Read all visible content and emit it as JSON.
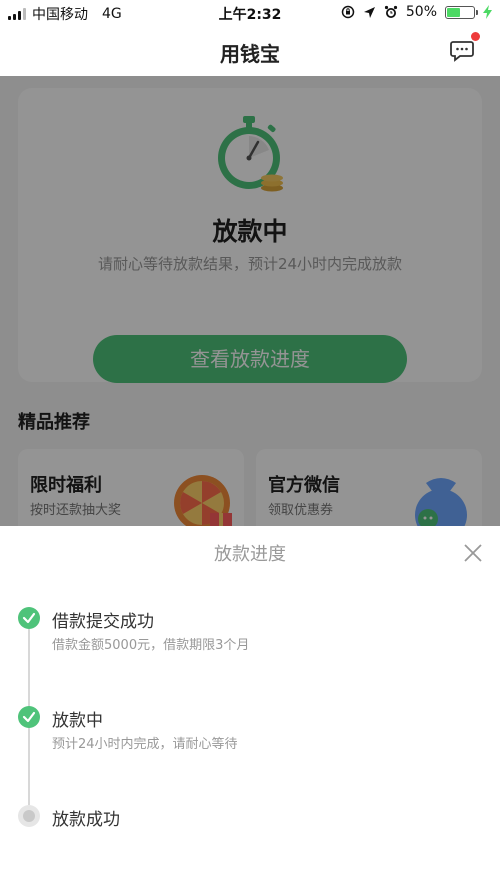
{
  "status_bar": {
    "carrier": "中国移动",
    "network": "4G",
    "time": "上午2:32",
    "battery": "50%",
    "battery_level": 0.5
  },
  "nav": {
    "title": "用钱宝",
    "has_unread": true
  },
  "status_card": {
    "title": "放款中",
    "description": "请耐心等待放款结果，预计24小时内完成放款",
    "button_label": "查看放款进度"
  },
  "recommend": {
    "title": "精品推荐",
    "items": [
      {
        "title": "限时福利",
        "subtitle": "按时还款抽大奖"
      },
      {
        "title": "官方微信",
        "subtitle": "领取优惠券"
      }
    ]
  },
  "sheet": {
    "title": "放款进度",
    "steps": [
      {
        "title": "借款提交成功",
        "subtitle": "借款金额5000元，借款期限3个月",
        "state": "done"
      },
      {
        "title": "放款中",
        "subtitle": "预计24小时内完成，请耐心等待",
        "state": "done"
      },
      {
        "title": "放款成功",
        "subtitle": "",
        "state": "pending"
      }
    ]
  },
  "colors": {
    "accent": "#4fc37a",
    "badge": "#ee3b3b",
    "battery": "#4cd964"
  }
}
